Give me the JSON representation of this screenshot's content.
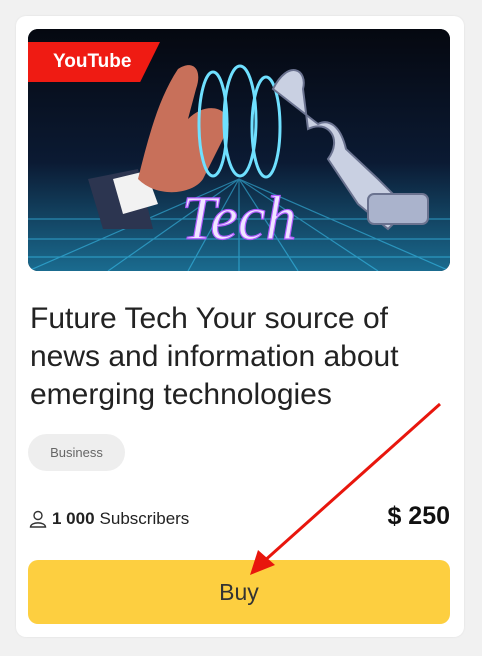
{
  "card": {
    "platform_badge": "YouTube",
    "thumbnail_text": "Tech",
    "title": "Future Tech Your source of news and information about emerging technologies",
    "category_tag": "Business",
    "subscribers_count": "1 000",
    "subscribers_label": "Subscribers",
    "price": "$ 250",
    "buy_label": "Buy"
  },
  "colors": {
    "badge": "#ef1b13",
    "buy_button": "#fdcf40",
    "annotation_arrow": "#e8160d"
  },
  "icons": {
    "subscribers": "user-icon"
  }
}
